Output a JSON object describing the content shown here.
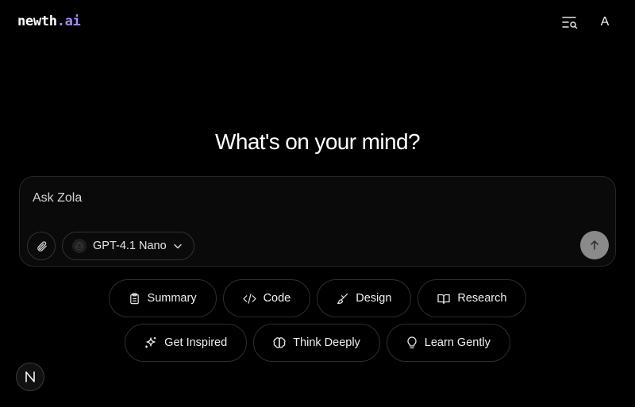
{
  "brand": {
    "name_main": "newth",
    "name_accent": ".ai"
  },
  "header": {
    "history_search_icon": "list-search-icon",
    "user_initial": "A"
  },
  "main": {
    "heading": "What's on your mind?"
  },
  "composer": {
    "placeholder": "Ask Zola",
    "value": "",
    "model": {
      "label": "GPT-4.1 Nano",
      "icon": "openai-icon"
    },
    "attach_icon": "paperclip-icon",
    "send_icon": "arrow-up-icon"
  },
  "suggestions": {
    "row1": [
      {
        "label": "Summary",
        "icon": "clipboard-icon"
      },
      {
        "label": "Code",
        "icon": "code-icon"
      },
      {
        "label": "Design",
        "icon": "brush-icon"
      },
      {
        "label": "Research",
        "icon": "book-icon"
      }
    ],
    "row2": [
      {
        "label": "Get Inspired",
        "icon": "sparkles-icon"
      },
      {
        "label": "Think Deeply",
        "icon": "brain-icon"
      },
      {
        "label": "Learn Gently",
        "icon": "lightbulb-icon"
      }
    ]
  },
  "footer_badge": {
    "letter": "N"
  },
  "colors": {
    "background": "#000000",
    "accent": "#a78bfa",
    "send_button": "#8a8a8a"
  }
}
